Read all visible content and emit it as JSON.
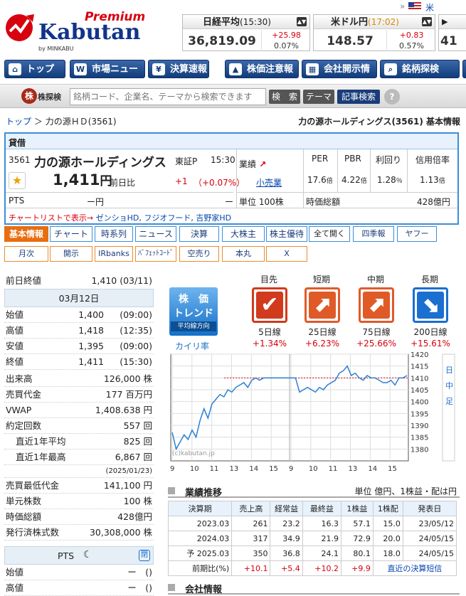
{
  "brand": {
    "premium": "Premium",
    "name": "Kabutan",
    "by": "by MINKABU"
  },
  "topbar": {
    "us_label": "米株",
    "double_chevron": "»"
  },
  "markets": [
    {
      "name": "日経平均",
      "time": "(15:30)",
      "value": "36,819.09",
      "change": "+25.98",
      "pct": "0.07%"
    },
    {
      "name": "米ドル円",
      "time": "(17:02)",
      "value": "148.57",
      "change": "+0.83",
      "pct": "0.57%"
    },
    {
      "name": "",
      "time": "",
      "value": "41",
      "change": "",
      "pct": ""
    }
  ],
  "nav": [
    "トップ",
    "市場ニュース",
    "決算速報",
    "株価注意報",
    "会社開示情報",
    "銘柄探検"
  ],
  "search": {
    "logo": "株探検",
    "logo_sub": "株",
    "placeholder": "銘柄コード、企業名、テーマから検索できます",
    "btn_search": "検　索",
    "btn_theme": "テーマ",
    "btn_news": "記事検索",
    "help": "?"
  },
  "breadcrumb": {
    "top": "トップ",
    "sep": "＞",
    "current": "力の源ＨＤ(3561)",
    "right": "力の源ホールディングス(3561) 基本情報"
  },
  "stock": {
    "credit": "貸借",
    "code": "3561",
    "name": "力の源ホールディングス",
    "market": "東証P",
    "time": "15:30",
    "price": "1,411",
    "yen": "円",
    "prev_label": "前日比",
    "change": "+1",
    "change_pct": "（+0.07%）",
    "pts_label": "PTS",
    "pts_value": "ー円",
    "pts_dash": "ー",
    "gyoseki": "業績",
    "industry": "小売業",
    "unit": "単位 100株",
    "per_h": "PER",
    "pbr_h": "PBR",
    "yield_h": "利回り",
    "margin_h": "信用倍率",
    "per": "17.6",
    "pbr": "4.22",
    "yield": "1.28",
    "margin": "1.13",
    "times": "倍",
    "pct": "％",
    "mcap_label": "時価総額",
    "mcap": "428億円",
    "links": [
      "チャートリストで表示→",
      "ゼンショHD",
      "フジオフード",
      "吉野家HD"
    ]
  },
  "tabs1": [
    "基本情報",
    "チャート",
    "時系列",
    "ニュース",
    "決算",
    "大株主",
    "株主優待",
    "全て開く",
    "四季報",
    "ヤフー"
  ],
  "tabs2": [
    "月次",
    "開示",
    "IRbanks",
    "ﾊﾞﾌｪｯﾄｺｰﾄﾞ",
    "空売り",
    "本丸",
    "X"
  ],
  "left": {
    "prev_close_label": "前日終値",
    "prev_close": "1,410 (03/11)",
    "date": "03月12日",
    "ohlc": [
      {
        "l": "始値",
        "v": "1,400",
        "t": "(09:00)"
      },
      {
        "l": "高値",
        "v": "1,418",
        "t": "(12:35)"
      },
      {
        "l": "安値",
        "v": "1,395",
        "t": "(09:00)"
      },
      {
        "l": "終値",
        "v": "1,411",
        "t": "(15:30)"
      }
    ],
    "stats": [
      {
        "l": "出来高",
        "v": "126,000 株"
      },
      {
        "l": "売買代金",
        "v": "177 百万円"
      },
      {
        "l": "VWAP",
        "v": "1,408.638 円"
      },
      {
        "l": "約定回数",
        "v": "557 回"
      },
      {
        "l": "直近1年平均",
        "v": "825 回"
      },
      {
        "l": "直近1年最高",
        "v": "6,867 回"
      },
      {
        "l": "",
        "v": "(2025/01/23)"
      },
      {
        "l": "売買最低代金",
        "v": "141,100 円"
      },
      {
        "l": "単元株数",
        "v": "100 株"
      },
      {
        "l": "時価総額",
        "v": "428億円"
      },
      {
        "l": "発行済株式数",
        "v": "30,308,000 株"
      }
    ],
    "pts_title": "PTS",
    "pts_btn": "閉",
    "pts_rows": [
      {
        "l": "始値",
        "v": "ー　()"
      },
      {
        "l": "高値",
        "v": "ー　()"
      }
    ]
  },
  "trend": {
    "title1": "株　価",
    "title2": "トレンド",
    "sub": "平均線方向",
    "kairi": "カイリ率",
    "items": [
      {
        "period": "目先",
        "line": "5日線",
        "rate": "+1.34%",
        "dir": "up",
        "color": "#d13a1c"
      },
      {
        "period": "短期",
        "line": "25日線",
        "rate": "+6.23%",
        "dir": "up",
        "color": "#e05a28"
      },
      {
        "period": "中期",
        "line": "75日線",
        "rate": "+25.66%",
        "dir": "up",
        "color": "#e05a28"
      },
      {
        "period": "長期",
        "line": "200日線",
        "rate": "+15.61%",
        "dir": "down",
        "color": "#1a6fd0"
      }
    ]
  },
  "chart_data": {
    "type": "line",
    "title": "",
    "watermark": "(c)kabutan.jp",
    "xlabel": "",
    "ylabel": "",
    "ylim": [
      1375,
      1420
    ],
    "y_ticks": [
      1380,
      1385,
      1390,
      1395,
      1400,
      1405,
      1410,
      1415,
      1420
    ],
    "x_ticks_day1": [
      "9",
      "10",
      "11",
      "13",
      "14",
      "15"
    ],
    "x_ticks_day2": [
      "9",
      "10",
      "11",
      "13",
      "14",
      "15"
    ],
    "side_label": [
      "日",
      "中",
      "足"
    ],
    "prev_close": 1410,
    "series": [
      {
        "name": "",
        "values": [
          1387,
          1380,
          1383,
          1386,
          1384,
          1388,
          1385,
          1392,
          1397,
          1393,
          1399,
          1401,
          1403,
          1402,
          1405,
          1404,
          1406,
          1407,
          1408,
          1406,
          1409,
          1410,
          1409,
          1410,
          1410,
          1410,
          1410,
          1410,
          1410,
          1410,
          1410,
          1410,
          1404,
          1405,
          1406,
          1405,
          1404,
          1406,
          1405,
          1407,
          1408,
          1409,
          1412,
          1413,
          1415,
          1411,
          1412,
          1410,
          1409,
          1411,
          1410,
          1410,
          1409,
          1408,
          1408,
          1409,
          1407,
          1410,
          1410,
          1411
        ]
      }
    ]
  },
  "results": {
    "title": "業績推移",
    "unit": "単位 億円、1株益・配は円",
    "headers": [
      "決算期",
      "売上高",
      "経常益",
      "最終益",
      "1株益",
      "1株配",
      "発表日"
    ],
    "rows": [
      [
        "2023.03",
        "261",
        "23.2",
        "16.3",
        "57.1",
        "15.0",
        "23/05/12"
      ],
      [
        "2024.03",
        "317",
        "34.9",
        "21.9",
        "72.9",
        "20.0",
        "24/05/15"
      ],
      [
        "予 2025.03",
        "350",
        "36.8",
        "24.1",
        "80.1",
        "18.0",
        "24/05/15"
      ]
    ],
    "ratio": [
      "前期比(%)",
      "+10.1",
      "+5.4",
      "+10.2",
      "+9.9"
    ],
    "ratio_link": "直近の決算短信"
  },
  "company": {
    "title": "会社情報"
  }
}
